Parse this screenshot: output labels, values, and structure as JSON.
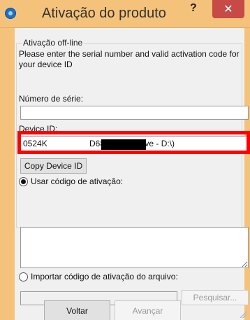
{
  "window": {
    "title": "Ativação do produto",
    "help_label": "?",
    "close_label": "✕"
  },
  "group": {
    "legend": "Ativação off-line",
    "instructions": "Please enter the serial number and valid activation code for your device ID"
  },
  "serial": {
    "label": "Número de série:",
    "value": ""
  },
  "device": {
    "label": "Device ID:",
    "value_prefix": "0524K",
    "value_suffix": "D68EA (Pendrive - D:\\)",
    "copy_button": "Copy Device ID"
  },
  "activation": {
    "use_code_label": "Usar código de ativação:",
    "use_code_selected": true,
    "code_value": "",
    "import_label": "Importar código de ativação do arquivo:",
    "file_value": "",
    "browse_button": "Pesquisar..."
  },
  "footer": {
    "back_button": "Voltar",
    "next_button": "Avançar"
  },
  "colors": {
    "titlebar": "#f4c27a",
    "close_button": "#c74a46",
    "highlight": "#ff0000"
  }
}
